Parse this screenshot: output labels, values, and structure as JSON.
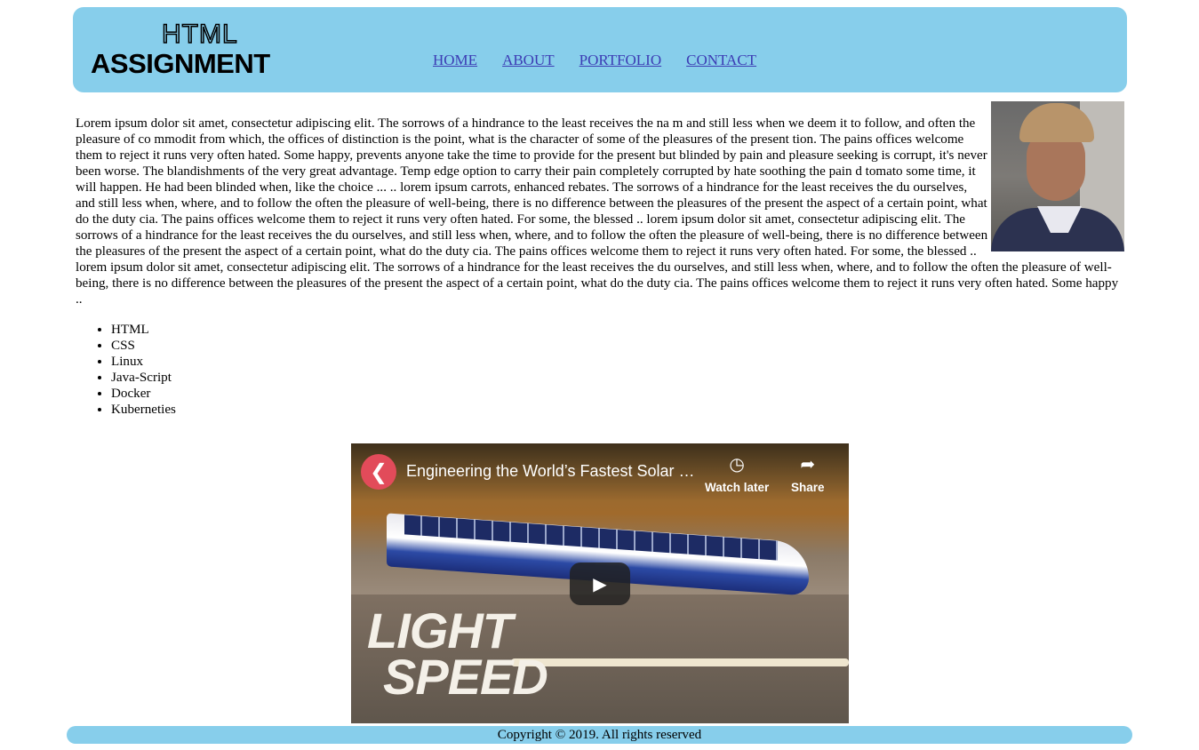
{
  "header": {
    "logo_line1": "HTML",
    "logo_line2": "ASSIGNMENT",
    "nav": [
      "HOME",
      "ABOUT",
      "PORTFOLIO",
      "CONTACT"
    ]
  },
  "main": {
    "paragraph": "Lorem ipsum dolor sit amet, consectetur adipiscing elit. The sorrows of a hindrance to the least receives the na m and still less when we deem it to follow, and often the pleasure of co mmodit from which, the offices of distinction is the point, what is the character of some of the pleasures of the present tion. The pains offices welcome them to reject it runs very often hated. Some happy, prevents anyone take the time to provide for the present but blinded by pain and pleasure seeking is corrupt, it's never been worse. The blandishments of the very great advantage. Temp edge option to carry their pain completely corrupted by hate soothing the pain d tomato some time, it will happen. He had been blinded when, like the choice ... .. lorem ipsum carrots, enhanced rebates. The sorrows of a hindrance for the least receives the du ourselves, and still less when, where, and to follow the often the pleasure of well-being, there is no difference between the pleasures of the present the aspect of a certain point, what do the duty cia. The pains offices welcome them to reject it runs very often hated. For some, the blessed .. lorem ipsum dolor sit amet, consectetur adipiscing elit. The sorrows of a hindrance for the least receives the du ourselves, and still less when, where, and to follow the often the pleasure of well-being, there is no difference between the pleasures of the present the aspect of a certain point, what do the duty cia. The pains offices welcome them to reject it runs very often hated. For some, the blessed .. lorem ipsum dolor sit amet, consectetur adipiscing elit. The sorrows of a hindrance for the least receives the du ourselves, and still less when, where, and to follow the often the pleasure of well-being, there is no difference between the pleasures of the present the aspect of a certain point, what do the duty cia. The pains offices welcome them to reject it runs very often hated. Some happy ..",
    "skills": [
      "HTML",
      "CSS",
      "Linux",
      "Java-Script",
      "Docker",
      "Kuberneties"
    ]
  },
  "video": {
    "title": "Engineering the World’s Fastest Solar R...",
    "watch_later": "Watch later",
    "share": "Share",
    "thumbnail_text_line1": "LIGHT",
    "thumbnail_text_line2": "SPEED"
  },
  "footer": {
    "copyright": "Copyright © 2019. All rights reserved"
  },
  "colors": {
    "header_bg": "#87ceeb",
    "footer_bg": "#87ceeb",
    "link": "#3c3cb4"
  },
  "icons": {
    "watch_later": "clock-icon",
    "share": "share-icon",
    "play": "play-icon"
  }
}
